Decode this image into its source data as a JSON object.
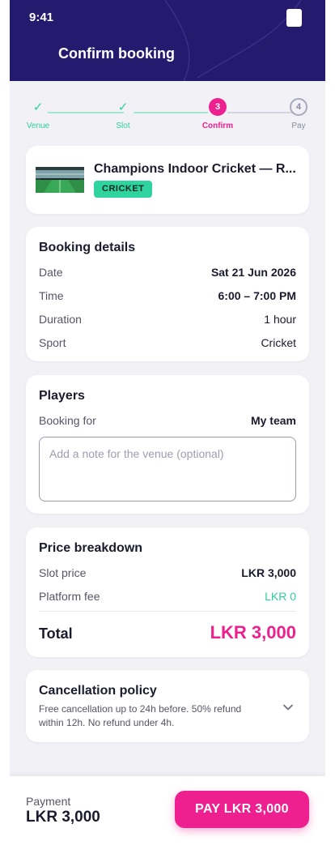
{
  "status_bar": {
    "time": "9:41"
  },
  "header": {
    "title": "Confirm booking"
  },
  "stepper": {
    "steps": [
      {
        "label": "Venue",
        "state": "done"
      },
      {
        "label": "Slot",
        "state": "done"
      },
      {
        "label": "Confirm",
        "number": "3",
        "state": "current"
      },
      {
        "label": "Pay",
        "number": "4",
        "state": "todo"
      }
    ]
  },
  "venue": {
    "name": "Champions Indoor Cricket — R...",
    "sport_badge": "CRICKET"
  },
  "booking_details": {
    "title": "Booking details",
    "rows": [
      {
        "label": "Date",
        "value": "Sat 21 Jun 2026"
      },
      {
        "label": "Time",
        "value": "6:00 – 7:00 PM"
      },
      {
        "label": "Duration",
        "value": "1 hour"
      },
      {
        "label": "Sport",
        "value": "Cricket"
      }
    ]
  },
  "players": {
    "title": "Players",
    "booking_for_label": "Booking for",
    "booking_for_value": "My team",
    "note_placeholder": "Add a note for the venue (optional)"
  },
  "price": {
    "title": "Price breakdown",
    "slot_label": "Slot price",
    "slot_value": "LKR 3,000",
    "fee_label": "Platform fee",
    "fee_value": "LKR 0",
    "total_label": "Total",
    "total_value": "LKR 3,000"
  },
  "policy": {
    "title": "Cancellation policy",
    "text": "Free cancellation up to 24h before. 50% refund within 12h. No refund under 4h."
  },
  "payment_bar": {
    "label": "Payment",
    "amount": "LKR 3,000",
    "button": "PAY LKR 3,000"
  },
  "colors": {
    "header_bg": "#241a6e",
    "accent_pink": "#ee1f8e",
    "accent_green": "#2ecf9a"
  },
  "icons": [
    "check-icon",
    "chevron-down-icon",
    "battery-icon"
  ]
}
